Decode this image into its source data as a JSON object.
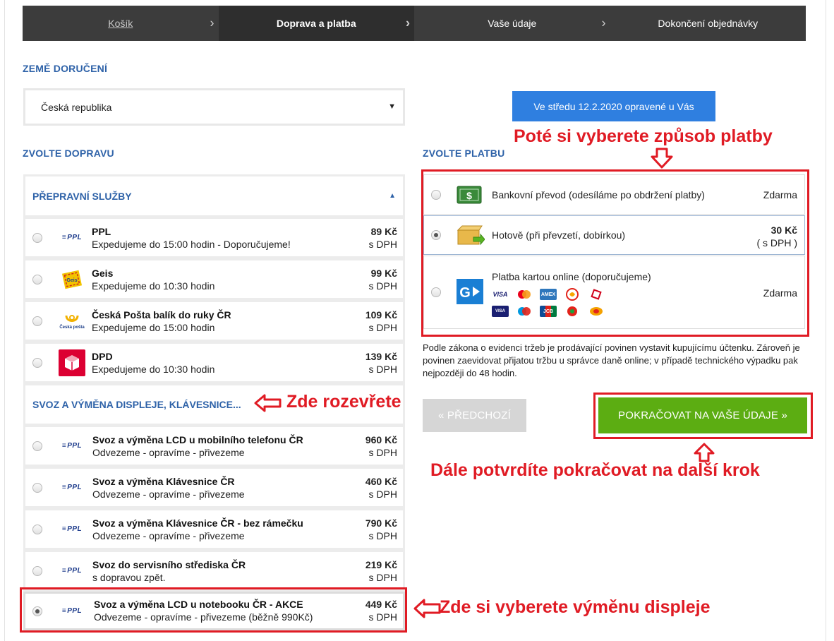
{
  "steps": [
    {
      "label": "Košík",
      "state": "done"
    },
    {
      "label": "Doprava a platba",
      "state": "active"
    },
    {
      "label": "Vaše údaje",
      "state": "todo"
    },
    {
      "label": "Dokončení objednávky",
      "state": "todo"
    }
  ],
  "country": {
    "title": "ZEMĚ DORUČENÍ",
    "selected": "Česká republika"
  },
  "delivery_date": "Ve středu 12.2.2020 opravené u Vás",
  "shipping": {
    "title": "ZVOLTE DOPRAVU",
    "group1": {
      "title": "PŘEPRAVNÍ SLUŽBY",
      "items": [
        {
          "name": "PPL",
          "desc": "Expedujeme do 15:00 hodin - Doporučujeme!",
          "price": "89 Kč",
          "tax": "s DPH",
          "icon": "ppl-icon",
          "logo_text": "PPL"
        },
        {
          "name": "Geis",
          "desc": "Expedujeme do 10:30 hodin",
          "price": "99 Kč",
          "tax": "s DPH",
          "icon": "geis-icon",
          "logo_text": "Geis"
        },
        {
          "name": "Česká Pošta balík do ruky ČR",
          "desc": "Expedujeme do 15:00 hodin",
          "price": "109 Kč",
          "tax": "s DPH",
          "icon": "ceska-posta-icon",
          "logo_text": "Česká pošta"
        },
        {
          "name": "DPD",
          "desc": "Expedujeme do 10:30 hodin",
          "price": "139 Kč",
          "tax": "s DPH",
          "icon": "dpd-icon",
          "logo_text": ""
        }
      ]
    },
    "group2": {
      "title": "SVOZ A VÝMĚNA DISPLEJE, KLÁVESNICE...",
      "items": [
        {
          "name": "Svoz a výměna LCD u mobilního telefonu ČR",
          "desc": "Odvezeme - opravíme - přivezeme",
          "price": "960 Kč",
          "tax": "s DPH",
          "logo_text": "PPL"
        },
        {
          "name": "Svoz a výměna Klávesnice ČR",
          "desc": "Odvezeme - opravíme - přivezeme",
          "price": "460 Kč",
          "tax": "s DPH",
          "logo_text": "PPL"
        },
        {
          "name": "Svoz a výměna Klávesnice ČR - bez rámečku",
          "desc": "Odvezeme - opravíme - přivezeme",
          "price": "790 Kč",
          "tax": "s DPH",
          "logo_text": "PPL"
        },
        {
          "name": "Svoz do servisního střediska ČR",
          "desc": "s dopravou zpět.",
          "price": "219 Kč",
          "tax": "s DPH",
          "logo_text": "PPL"
        },
        {
          "name": "Svoz a výměna LCD u notebooku ČR - AKCE",
          "desc": "Odvezeme - opravíme - přivezeme (běžně 990Kč)",
          "price": "449 Kč",
          "tax": "s DPH",
          "logo_text": "PPL"
        }
      ]
    }
  },
  "payment": {
    "title": "ZVOLTE PLATBU",
    "items": [
      {
        "label": "Bankovní převod (odesíláme po obdržení platby)",
        "price": "Zdarma",
        "tax": ""
      },
      {
        "label": "Hotově (při převzetí, dobírkou)",
        "price": "30 Kč",
        "tax": "( s DPH )"
      },
      {
        "label": "Platba kartou online (doporučujeme)",
        "price": "Zdarma",
        "tax": ""
      }
    ],
    "card_logos": [
      {
        "name": "visa-logo",
        "text": "VISA"
      },
      {
        "name": "mastercard-logo",
        "text": ""
      },
      {
        "name": "amex-logo",
        "text": "AMEX"
      },
      {
        "name": "sodexo-logo",
        "text": ""
      },
      {
        "name": "benefit-logo",
        "text": ""
      },
      {
        "name": "visa-electron-logo",
        "text": "VISA"
      },
      {
        "name": "maestro-logo",
        "text": ""
      },
      {
        "name": "jcb-logo",
        "text": "JCB"
      },
      {
        "name": "edenred-logo",
        "text": ""
      },
      {
        "name": "cheque-dejeuner-logo",
        "text": ""
      }
    ]
  },
  "legal_text": "Podle zákona o evidenci tržeb je prodávající povinen vystavit kupujícímu účtenku. Zároveň je povinen zaevidovat přijatou tržbu u správce daně online; v případě technického výpadku pak nejpozději do 48 hodin.",
  "buttons": {
    "prev": "« PŘEDCHOZÍ",
    "next": "POKRAČOVAT NA VAŠE ÚDAJE »"
  },
  "annotations": {
    "payment": "Poté si vyberete způsob platby",
    "open_group": "Zde rozevřete",
    "select_display": "Zde si vyberete výměnu displeje",
    "continue": "Dále potvrdíte pokračovat na další krok"
  },
  "colors": {
    "accent_blue": "#2e62a8",
    "button_blue": "#2f7fe0",
    "annotation_red": "#e01b24",
    "continue_green": "#5cad12"
  }
}
